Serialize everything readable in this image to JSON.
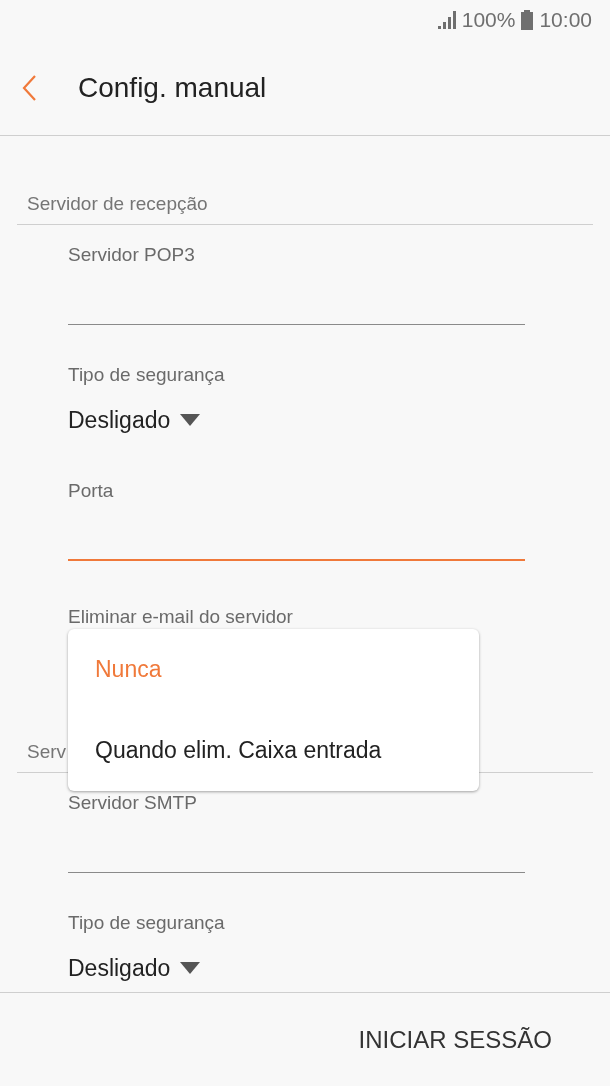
{
  "status_bar": {
    "battery": "100%",
    "time": "10:00"
  },
  "header": {
    "title": "Config. manual"
  },
  "sections": [
    {
      "title": "Servidor de recepção",
      "fields": [
        {
          "kind": "text",
          "label": "Servidor POP3",
          "focused": false
        },
        {
          "kind": "dropdown",
          "label": "Tipo de segurança",
          "value": "Desligado"
        },
        {
          "kind": "text",
          "label": "Porta",
          "focused": true
        },
        {
          "kind": "menu",
          "label": "Eliminar e-mail do servidor",
          "options": [
            {
              "label": "Nunca",
              "selected": true
            },
            {
              "label": "Quando elim. Caixa entrada",
              "selected": false
            }
          ]
        }
      ]
    },
    {
      "title": "Serv",
      "fields": [
        {
          "kind": "text",
          "label": "Servidor SMTP",
          "focused": false
        },
        {
          "kind": "dropdown",
          "label": "Tipo de segurança",
          "value": "Desligado"
        }
      ]
    }
  ],
  "footer": {
    "button": "INICIAR SESSÃO"
  }
}
